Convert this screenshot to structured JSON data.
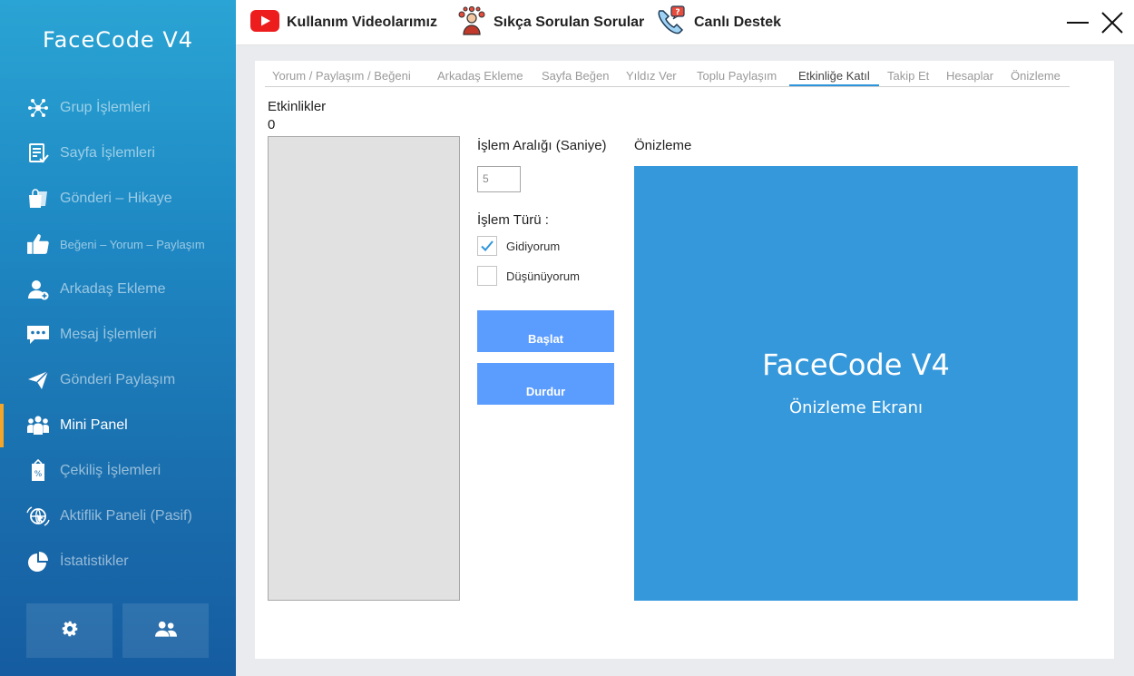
{
  "app": {
    "title": "FaceCode V4"
  },
  "sidebar": {
    "items": [
      {
        "label": "Grup İşlemleri",
        "icon": "network-icon"
      },
      {
        "label": "Sayfa İşlemleri",
        "icon": "document-icon"
      },
      {
        "label": "Gönderi – Hikaye",
        "icon": "bag-icon"
      },
      {
        "label": "Beğeni – Yorum – Paylaşım",
        "icon": "thumbs-up-icon"
      },
      {
        "label": "Arkadaş Ekleme",
        "icon": "add-friend-icon"
      },
      {
        "label": "Mesaj İşlemleri",
        "icon": "chat-icon"
      },
      {
        "label": "Gönderi Paylaşım",
        "icon": "paper-plane-icon"
      },
      {
        "label": "Mini Panel",
        "icon": "users-icon",
        "active": true
      },
      {
        "label": "Çekiliş İşlemleri",
        "icon": "price-tag-icon"
      },
      {
        "label": "Aktiflik Paneli (Pasif)",
        "icon": "globe-cursor-icon"
      },
      {
        "label": "İstatistikler",
        "icon": "pie-chart-icon"
      }
    ],
    "bottom_buttons": [
      {
        "icon": "gear-icon"
      },
      {
        "icon": "user-group-icon"
      }
    ]
  },
  "topbar": {
    "links": [
      {
        "label": "Kullanım Videolarımız",
        "icon": "youtube-icon"
      },
      {
        "label": "Sıkça Sorulan Sorular",
        "icon": "faq-person-icon"
      },
      {
        "label": "Canlı Destek",
        "icon": "phone-support-icon"
      }
    ]
  },
  "tabs": [
    "Yorum / Paylaşım / Beğeni",
    "Arkadaş Ekleme",
    "Sayfa Beğen",
    "Yıldız Ver",
    "Toplu Paylaşım",
    "Etkinliğe Katıl",
    "Takip Et",
    "Hesaplar",
    "Önizleme"
  ],
  "active_tab": "Etkinliğe Katıl",
  "events": {
    "title": "Etkinlikler",
    "count": "0"
  },
  "form": {
    "interval_label": "İşlem Aralığı (Saniye)",
    "interval_value": "5",
    "type_label": "İşlem Türü :",
    "options": [
      {
        "label": "Gidiyorum",
        "checked": true
      },
      {
        "label": "Düşünüyorum",
        "checked": false
      }
    ],
    "start_label": "Başlat",
    "stop_label": "Durdur"
  },
  "preview": {
    "label": "Önizleme",
    "title": "FaceCode V4",
    "subtitle": "Önizleme Ekranı"
  },
  "colors": {
    "accent": "#f4a62a",
    "button": "#5b9cff",
    "preview_bg": "#3598db",
    "tab_underline": "#2f95db"
  }
}
